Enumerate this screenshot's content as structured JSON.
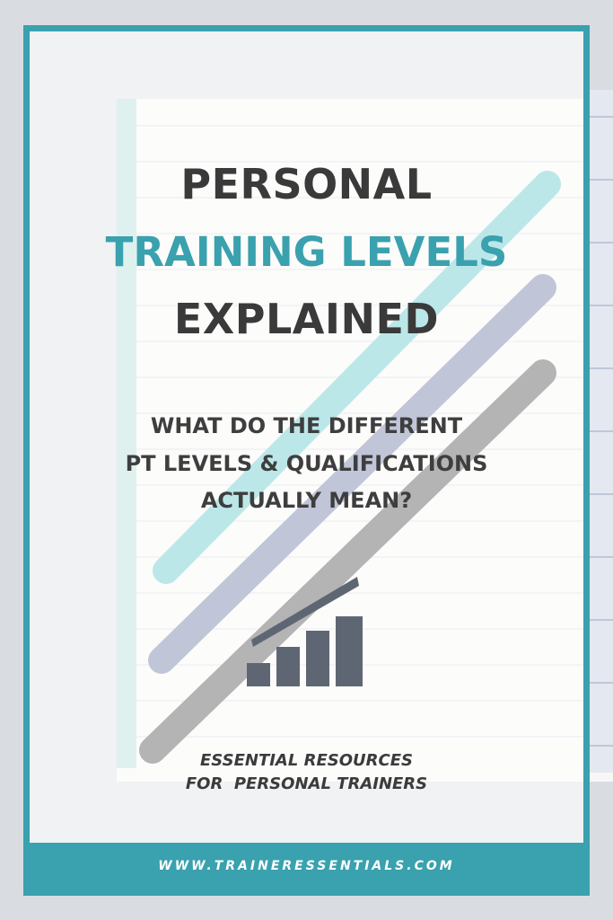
{
  "colors": {
    "accent": "#3aa1ae",
    "dark_text": "#3a3a3a",
    "icon": "#5f6673"
  },
  "headline": {
    "line1": "PERSONAL",
    "line2": "TRAINING LEVELS",
    "line3": "EXPLAINED"
  },
  "subheadline": {
    "line1": "WHAT DO THE DIFFERENT",
    "line2": "PT LEVELS & QUALIFICATIONS",
    "line3": "ACTUALLY MEAN?"
  },
  "icon": "bar-chart-growth-icon",
  "tagline": {
    "line1": "ESSENTIAL RESOURCES",
    "line2": "FOR  PERSONAL TRAINERS"
  },
  "footer": {
    "url": "WWW.TRAINERESSENTIALS.COM"
  }
}
